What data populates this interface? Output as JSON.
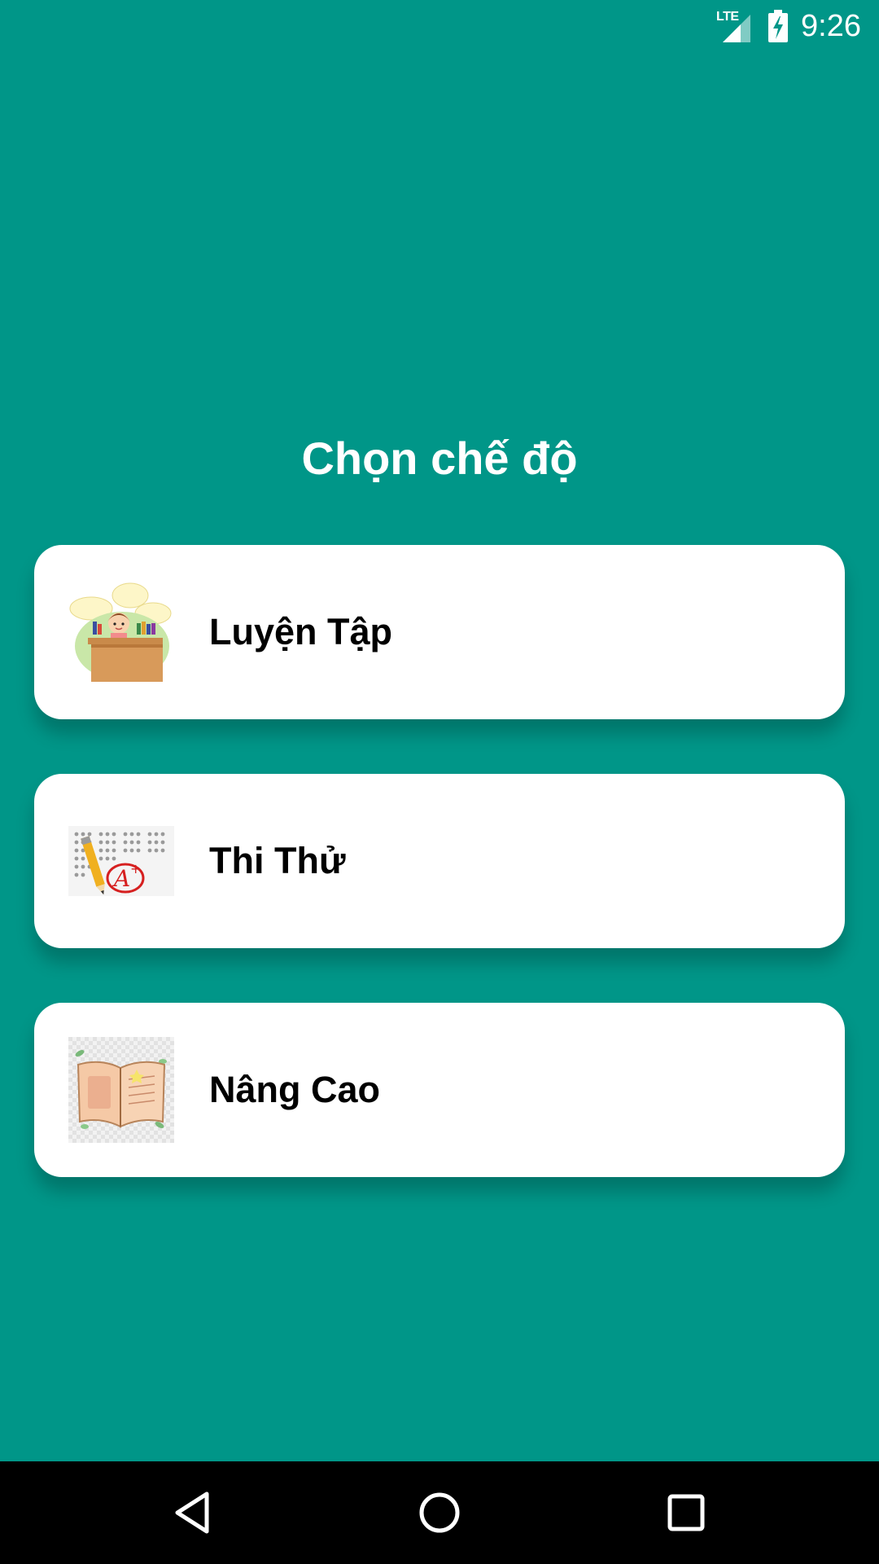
{
  "status_bar": {
    "network_label": "LTE",
    "time": "9:26",
    "icons": [
      "signal-icon",
      "battery-charging-icon"
    ]
  },
  "title": "Chọn chế độ",
  "modes": [
    {
      "label": "Luyện Tập",
      "icon": "student-desk-icon"
    },
    {
      "label": "Thi Thử",
      "icon": "exam-sheet-icon"
    },
    {
      "label": "Nâng Cao",
      "icon": "open-book-icon"
    }
  ],
  "nav_bar": {
    "buttons": [
      "back-icon",
      "home-icon",
      "recents-icon"
    ]
  },
  "colors": {
    "background": "#009688",
    "card": "#ffffff",
    "nav_bar": "#000000"
  }
}
